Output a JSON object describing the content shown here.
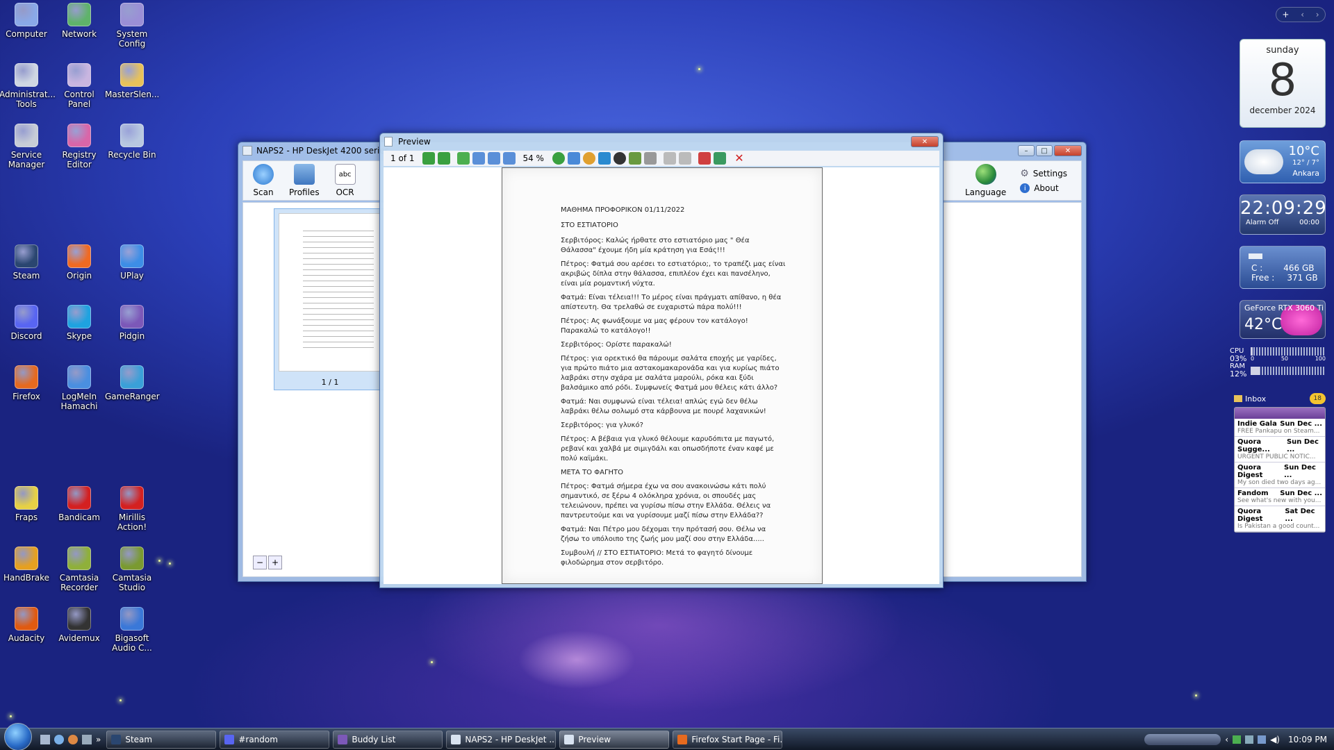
{
  "desktop_icons": [
    {
      "label": "Computer",
      "icon": "computer-icon",
      "color": "#8aa9e8"
    },
    {
      "label": "Network",
      "icon": "network-icon",
      "color": "#5fb36a"
    },
    {
      "label": "System Config",
      "icon": "system-config-icon",
      "color": "#9b8fd6"
    },
    {
      "label": "Administrat... Tools",
      "icon": "admin-tools-icon",
      "color": "#cfd6e2"
    },
    {
      "label": "Control Panel",
      "icon": "control-panel-icon",
      "color": "#c9b6e0"
    },
    {
      "label": "MasterSlen...",
      "icon": "folder-icon",
      "color": "#e8c25a"
    },
    {
      "label": "Service Manager",
      "icon": "gear-icon",
      "color": "#c7ccd6"
    },
    {
      "label": "Registry Editor",
      "icon": "registry-icon",
      "color": "#d966a8"
    },
    {
      "label": "Recycle Bin",
      "icon": "recycle-bin-icon",
      "color": "#b8c8e0"
    },
    {
      "label": "Steam",
      "icon": "steam-icon",
      "color": "#2a4670"
    },
    {
      "label": "Origin",
      "icon": "origin-icon",
      "color": "#f06a22"
    },
    {
      "label": "UPlay",
      "icon": "uplay-icon",
      "color": "#3d8ee6"
    },
    {
      "label": "Discord",
      "icon": "discord-icon",
      "color": "#5865f2"
    },
    {
      "label": "Skype",
      "icon": "skype-icon",
      "color": "#1ea3e0"
    },
    {
      "label": "Pidgin",
      "icon": "pidgin-icon",
      "color": "#7c58b8"
    },
    {
      "label": "Firefox",
      "icon": "firefox-icon",
      "color": "#e66a1f"
    },
    {
      "label": "LogMeIn Hamachi",
      "icon": "hamachi-icon",
      "color": "#4a8fe0"
    },
    {
      "label": "GameRanger",
      "icon": "gameranger-icon",
      "color": "#3aa0d8"
    },
    {
      "label": "Fraps",
      "icon": "fraps-icon",
      "color": "#e6d045"
    },
    {
      "label": "Bandicam",
      "icon": "bandicam-icon",
      "color": "#d42020"
    },
    {
      "label": "Mirillis Action!",
      "icon": "action-icon",
      "color": "#d42020"
    },
    {
      "label": "HandBrake",
      "icon": "handbrake-icon",
      "color": "#e6a020"
    },
    {
      "label": "Camtasia Recorder",
      "icon": "camtasia-recorder-icon",
      "color": "#8fb03a"
    },
    {
      "label": "Camtasia Studio",
      "icon": "camtasia-studio-icon",
      "color": "#7a9a30"
    },
    {
      "label": "Audacity",
      "icon": "audacity-icon",
      "color": "#e05a10"
    },
    {
      "label": "Avidemux",
      "icon": "avidemux-icon",
      "color": "#333333"
    },
    {
      "label": "Bigasoft Audio C...",
      "icon": "audio-converter-icon",
      "color": "#3a78d8"
    }
  ],
  "naps2": {
    "title": "NAPS2 - HP DeskJet 4200 series",
    "toolbar": {
      "scan": "Scan",
      "profiles": "Profiles",
      "ocr": "OCR",
      "ocr_icon_text": "abc",
      "language": "Language",
      "settings": "Settings",
      "about": "About"
    },
    "thumb_label": "1 / 1"
  },
  "preview": {
    "title": "Preview",
    "page_indicator": "1 of 1",
    "zoom": "54 %",
    "document": {
      "lines": [
        "ΜΑΘΗΜΑ ΠΡΟΦΟΡΙΚΟΝ 01/11/2022",
        "ΣΤΟ ΕΣΤΙΑΤΟΡΙΟ",
        "Σερβιτόρος: Καλώς ήρθατε στο εστιατόριο μας \" Θέα Θάλασσα\" έχουμε ήδη μία κράτηση για Εσάς!!!",
        "Πέτρος: Φατμά σου αρέσει το εστιατόριο;, το τραπέζι μας είναι ακριβώς δίπλα στην θάλασσα, επιπλέον έχει και πανσέληνο, είναι μία ρομαντική νύχτα.",
        "Φατμά: Είναι τέλεια!!! Το μέρος είναι πράγματι απίθανο, η θέα απίστευτη. Θα τρελαθώ σε ευχαριστώ πάρα πολύ!!!",
        "Πέτρος: Ας φωνάξουμε να μας φέρουν τον κατάλογο! Παρακαλώ το κατάλογο!!",
        "Σερβιτόρος: Ορίστε παρακαλώ!",
        "Πέτρος: για ορεκτικό θα πάρουμε σαλάτα εποχής με γαρίδες, για πρώτο πιάτο μια αστακομακαρονάδα και για κυρίως πιάτο λαβράκι στην σχάρα με σαλάτα μαρούλι, ρόκα και ξύδι βαλσάμικο από ρόδι. Συμφωνείς Φατμά μου θέλεις κάτι άλλο?",
        "Φατμά: Ναι συμφωνώ είναι τέλεια! απλώς εγώ δεν θέλω λαβράκι θέλω σολωμό στα κάρβουνα με πουρέ λαχανικών!",
        "Σερβιτόρος: για γλυκό?",
        "Πέτρος: Α βέβαια για γλυκό θέλουμε καρυδόπιτα με παγωτό, ρεβανί και χαλβά με σιμιγδάλι και οπωσδήποτε έναν καφέ με πολύ καϊμάκι.",
        "ΜΕΤΑ ΤΟ ΦΑΓΗΤΟ",
        "Πέτρος: Φατμά σήμερα έχω να σου ανακοινώσω κάτι πολύ σημαντικό, σε ξέρω 4 ολόκληρα χρόνια, οι σπουδές μας τελειώνουν, πρέπει να γυρίσω πίσω στην Ελλάδα. Θέλεις να παντρευτούμε και να γυρίσουμε μαζί πίσω στην Ελλάδα??",
        "Φατμά: Ναι Πέτρο μου δέχομαι την πρότασή σου. Θέλω να ζήσω το υπόλοιπο της ζωής μου μαζί σου στην Ελλάδα.....",
        "Συμβουλή // ΣΤΟ ΕΣΤΙΑΤΟΡΙΟ: Μετά το φαγητό δίνουμε φιλοδώρημα στον σερβιτόρο."
      ]
    }
  },
  "gadgets": {
    "calendar": {
      "day_name": "sunday",
      "day": "8",
      "month_year": "december 2024"
    },
    "weather": {
      "temp": "10°C",
      "range": "12° / 7°",
      "city": "Ankara"
    },
    "clock": {
      "time": "22:09:29",
      "alarm": "Alarm Off",
      "alarm_time": "00:00"
    },
    "drive": {
      "label": "C :",
      "size": "466 GB",
      "free_label": "Free :",
      "free": "371 GB"
    },
    "gpu": {
      "name": "GeForce RTX 3060 Ti",
      "temp": "42°C"
    },
    "meter": {
      "cpu_label": "CPU",
      "cpu": "03%",
      "ram_label": "RAM",
      "ram": "12%",
      "scale": [
        "0",
        "50",
        "100"
      ],
      "cpu_level": 0.03,
      "ram_level": 0.12
    },
    "inbox": {
      "title": "Inbox",
      "count": "18",
      "items": [
        {
          "from": "Indie Gala",
          "date": "Sun Dec ...",
          "preview": "FREE Pankapu on Steam..."
        },
        {
          "from": "Quora Sugge...",
          "date": "Sun Dec ...",
          "preview": "URGENT PUBLIC NOTIC..."
        },
        {
          "from": "Quora Digest",
          "date": "Sun Dec ...",
          "preview": "My son died two days ag..."
        },
        {
          "from": "Fandom",
          "date": "Sun Dec ...",
          "preview": "See what's new with you..."
        },
        {
          "from": "Quora Digest",
          "date": "Sat Dec ...",
          "preview": "Is Pakistan a good count..."
        }
      ]
    }
  },
  "taskbar": {
    "tasks": [
      {
        "label": "Steam",
        "icon": "steam-icon",
        "color": "#2a4670"
      },
      {
        "label": "#random",
        "icon": "discord-icon",
        "color": "#5865f2"
      },
      {
        "label": "Buddy List",
        "icon": "pidgin-icon",
        "color": "#7c58b8"
      },
      {
        "label": "NAPS2 - HP DeskJet ...",
        "icon": "naps2-icon",
        "color": "#d8e2f0"
      },
      {
        "label": "Preview",
        "icon": "preview-icon",
        "color": "#d8e2f0"
      },
      {
        "label": "Firefox Start Page - Fi...",
        "icon": "firefox-icon",
        "color": "#e66a1f"
      }
    ],
    "clock": "10:09 PM",
    "overflow_label": "»"
  },
  "colors": {
    "accent": "#2b3fb8",
    "window_frame": "#aac8eb"
  }
}
